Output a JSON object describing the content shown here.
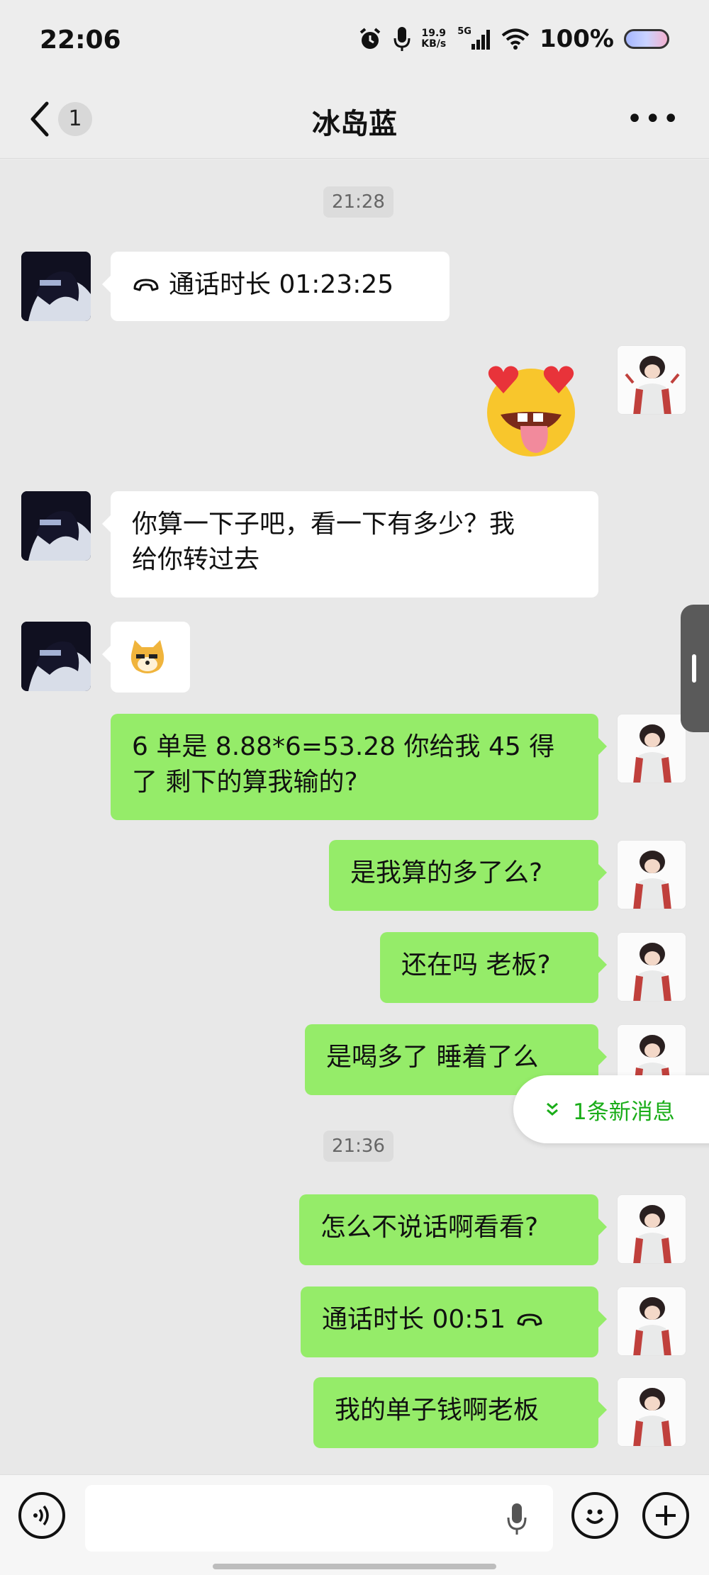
{
  "status_bar": {
    "time": "22:06",
    "net_speed_value": "19.9",
    "net_speed_unit": "KB/s",
    "network_type": "5G",
    "battery": "100%"
  },
  "nav": {
    "unread_count": "1",
    "title": "冰岛蓝"
  },
  "messages": [
    {
      "type": "timestamp",
      "text": "21:28"
    },
    {
      "type": "call",
      "direction": "in",
      "text": "通话时长 01:23:25"
    },
    {
      "type": "sticker",
      "direction": "out",
      "sticker": "heart-eyes-tongue-emoji"
    },
    {
      "type": "text",
      "direction": "in",
      "line1": "你算一下子吧，看一下有多少？我",
      "line2": "给你转过去"
    },
    {
      "type": "emoji",
      "direction": "in",
      "emoji": "🐱"
    },
    {
      "type": "text",
      "direction": "out",
      "line1": "6 单是 8.88*6=53.28 你给我 45 得",
      "line2": "了 剩下的算我输的?"
    },
    {
      "type": "text",
      "direction": "out",
      "text": "是我算的多了么?"
    },
    {
      "type": "text",
      "direction": "out",
      "text": "还在吗 老板?"
    },
    {
      "type": "text",
      "direction": "out",
      "text": "是喝多了 睡着了么"
    },
    {
      "type": "timestamp",
      "text": "21:36"
    },
    {
      "type": "text",
      "direction": "out",
      "text": "怎么不说话啊看看?"
    },
    {
      "type": "call",
      "direction": "out",
      "text": "通话时长 00:51"
    },
    {
      "type": "text",
      "direction": "out",
      "text": "我的单子钱啊老板"
    }
  ],
  "new_message_pill": "1条新消息",
  "colors": {
    "outgoing_bubble": "#95ec69",
    "incoming_bubble": "#ffffff",
    "chat_background": "#e8e8e8",
    "accent_green": "#1aad19"
  }
}
